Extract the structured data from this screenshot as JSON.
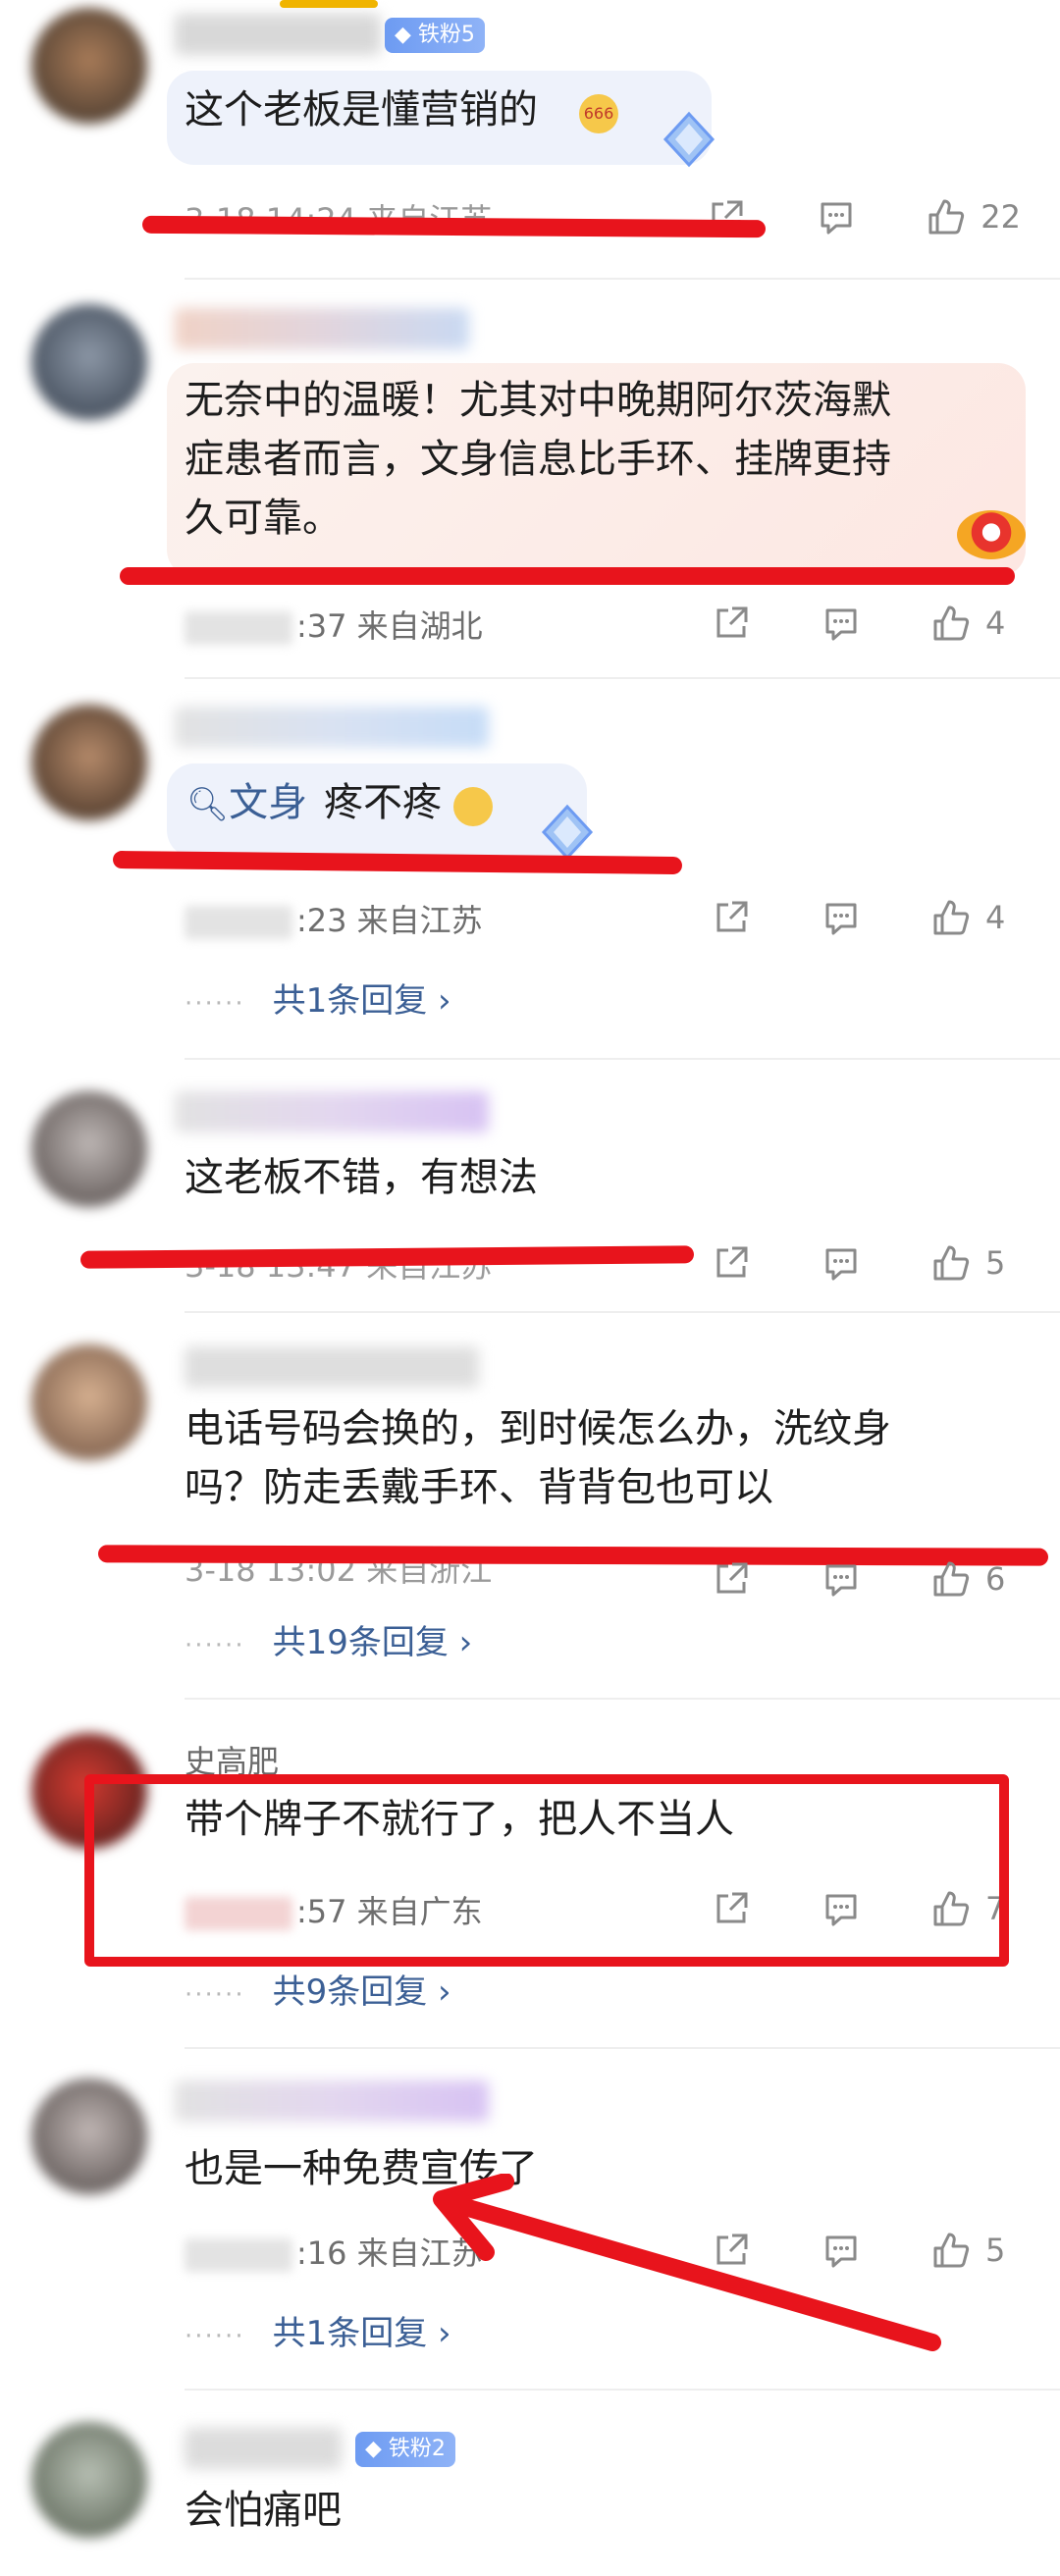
{
  "comments": [
    {
      "badge": "铁粉5",
      "text": "这个老板是懂营销的",
      "meta": "3-18 14:24 来自江苏",
      "likes": "22"
    },
    {
      "text_lines": [
        "无奈中的温暖！尤其对中晚期阿尔茨海默",
        "症患者而言，文身信息比手环、挂牌更持",
        "久可靠。"
      ],
      "meta_suffix": ":37",
      "location": "来自湖北",
      "likes": "4"
    },
    {
      "search_word": "文身",
      "text": "疼不疼",
      "meta_suffix": ":23",
      "location": "来自江苏",
      "likes": "4",
      "replies": "共1条回复"
    },
    {
      "text": "这老板不错，有想法",
      "meta": "3-18 13:47 来自江苏",
      "likes": "5"
    },
    {
      "text_lines": [
        "电话号码会换的，到时候怎么办，洗纹身",
        "吗？防走丢戴手环、背背包也可以"
      ],
      "meta": "3-18 13:02 来自浙江",
      "likes": "6",
      "replies": "共19条回复"
    },
    {
      "username": "史高肥",
      "text": "带个牌子不就行了，把人不当人",
      "meta_suffix": ":57",
      "location": "来自广东",
      "likes": "7",
      "replies": "共9条回复"
    },
    {
      "text": "也是一种免费宣传了",
      "meta_suffix": ":16",
      "location": "来自江苏",
      "likes": "5",
      "replies": "共1条回复"
    },
    {
      "badge": "铁粉2",
      "text": "会怕痛吧"
    }
  ],
  "colors": {
    "annotation_red": "#e8141c",
    "link_blue": "#3b5f95",
    "badge_blue": "#6d9bf2"
  }
}
